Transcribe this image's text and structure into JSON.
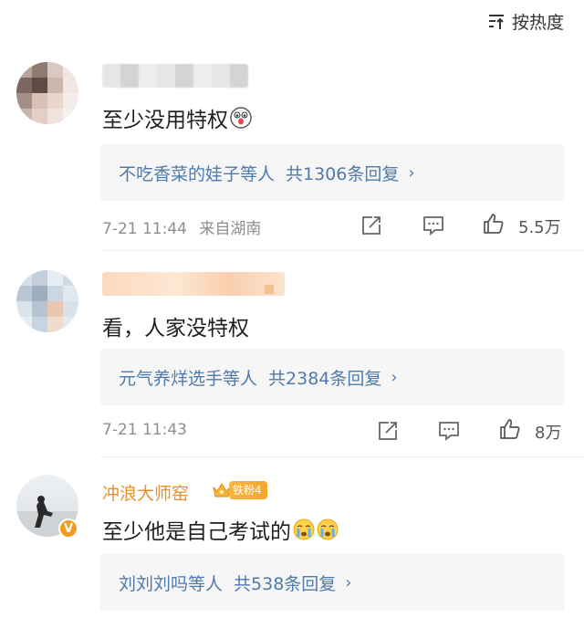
{
  "header": {
    "sort_label": "按热度"
  },
  "comments": [
    {
      "text": "至少没用特权",
      "reply_summary": "不吃香菜的娃子等人",
      "reply_count": "共1306条回复",
      "time": "7-21 11:44",
      "location": "来自湖南",
      "likes": "5.5万"
    },
    {
      "text": "看，人家没特权",
      "reply_summary": "元气养烊选手等人",
      "reply_count": "共2384条回复",
      "time": "7-21 11:43",
      "location": "",
      "likes": "8万"
    },
    {
      "username": "冲浪大师窑",
      "fan_badge": "铁粉4",
      "verified_mark": "V",
      "text": "至少他是自己考试的",
      "reply_summary": "刘刘刘吗等人",
      "reply_count": "共538条回复"
    }
  ],
  "icons": {
    "sort": "sort-icon",
    "share": "share-icon",
    "comment": "comment-icon",
    "like": "thumbs-up-icon"
  },
  "colors": {
    "link": "#4f7bab",
    "username": "#e8902a",
    "badge": "#f4a72e",
    "meta": "#8e8e8e",
    "reply_bg": "#f6f6f6"
  }
}
